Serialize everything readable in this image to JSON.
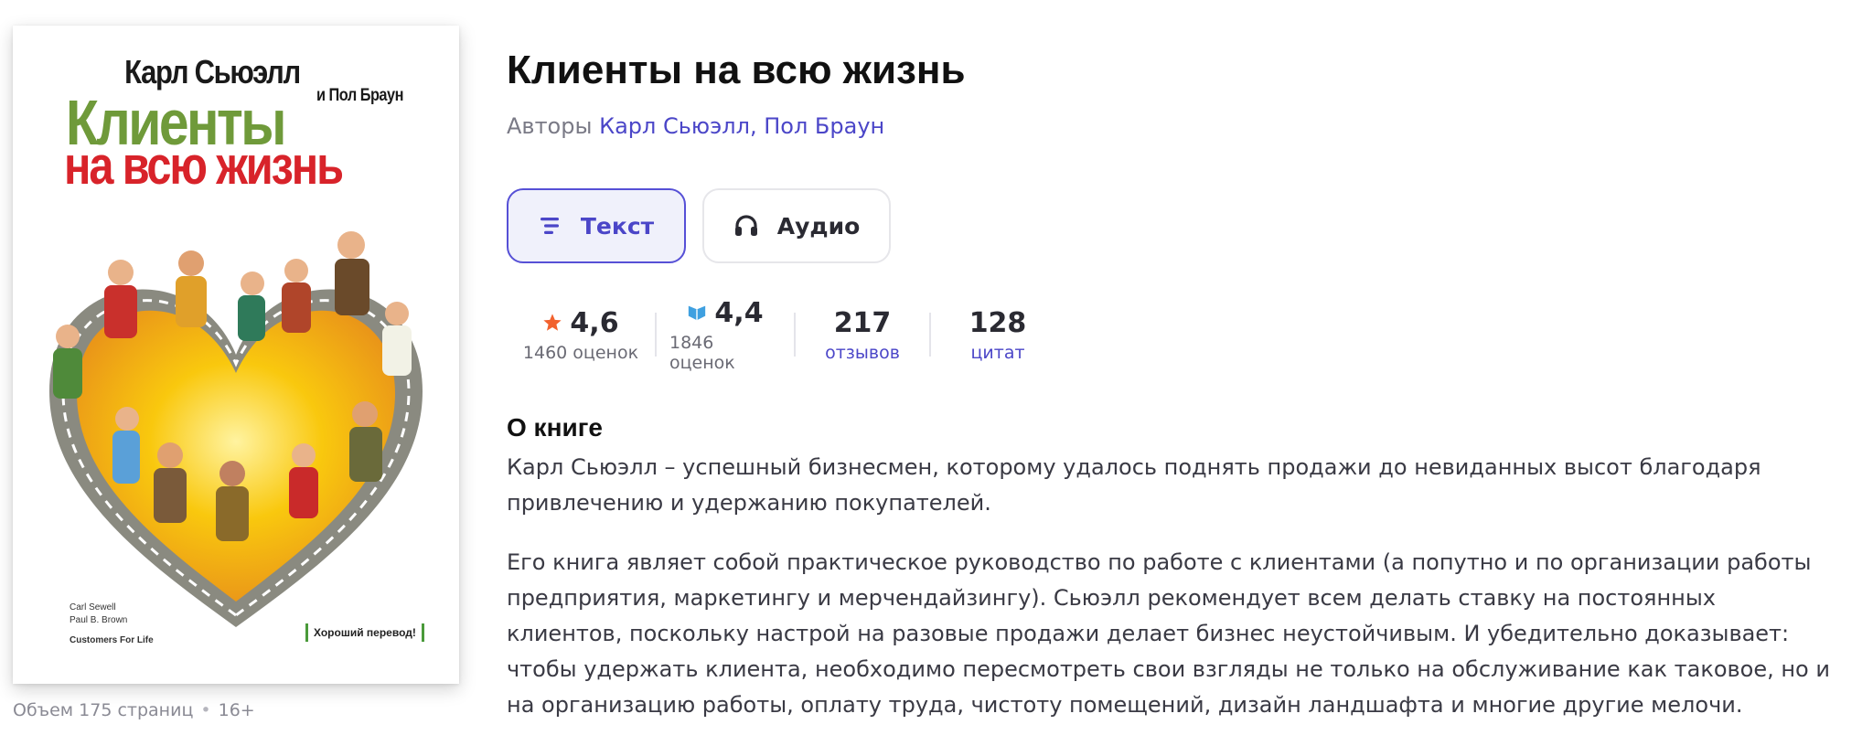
{
  "cover": {
    "author": "Карл Сьюэлл",
    "coauthor": "и Пол Браун",
    "title_line1": "Клиенты",
    "title_line2": "на всю жизнь",
    "en_author1": "Carl Sewell",
    "en_author2": "Paul B. Brown",
    "en_title": "Customers For Life",
    "badge": "Хороший перевод!"
  },
  "meta": {
    "pages": "Объем 175 страниц",
    "age": "16+"
  },
  "book": {
    "title": "Клиенты на всю жизнь",
    "authors_label": "Авторы",
    "authors": "Карл Сьюэлл, Пол Браун"
  },
  "formats": {
    "text_label": "Текст",
    "audio_label": "Аудио"
  },
  "stats": {
    "rating1": {
      "value": "4,6",
      "label": "1460 оценок"
    },
    "rating2": {
      "value": "4,4",
      "label": "1846 оценок"
    },
    "reviews": {
      "value": "217",
      "label": "отзывов"
    },
    "quotes": {
      "value": "128",
      "label": "цитат"
    }
  },
  "about": {
    "heading": "О книге",
    "p1": "Карл Сьюэлл – успешный бизнесмен, которому удалось поднять продажи до невиданных высот благодаря привлечению и удержанию покупателей.",
    "p2": "Его книга являет собой практическое руководство по работе с клиентами (а попутно и по организации работы предприятия, маркетингу и мерчендайзингу). Сьюэлл рекомендует всем делать ставку на постоянных клиентов, поскольку настрой на разовые продажи делает бизнес неустойчивым. И убедительно доказывает: чтобы удержать клиента, необходимо пересмотреть свои взгляды не только на обслуживание как таковое, но и на организацию работы, оплату труда, чистоту помещений, дизайн ландшафта и многие другие мелочи."
  },
  "colors": {
    "accent": "#4b46c8",
    "star": "#f2622e",
    "bookmate": "#3fa0e0"
  }
}
